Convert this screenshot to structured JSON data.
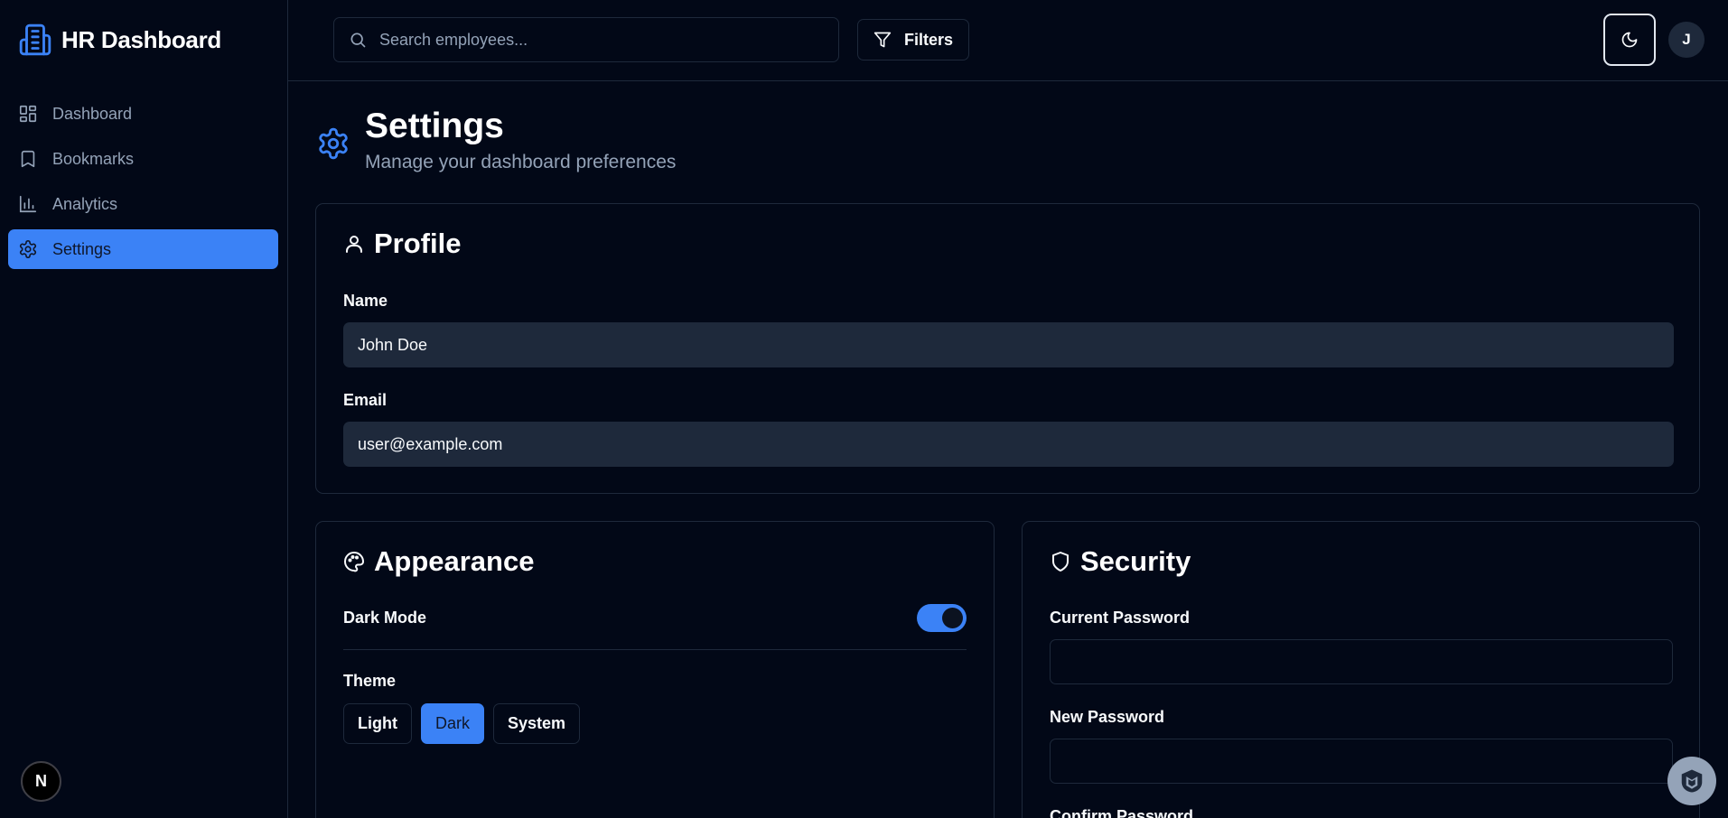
{
  "app": {
    "title": "HR Dashboard"
  },
  "sidebar": {
    "items": [
      {
        "label": "Dashboard",
        "icon": "dashboard-icon",
        "active": false
      },
      {
        "label": "Bookmarks",
        "icon": "bookmark-icon",
        "active": false
      },
      {
        "label": "Analytics",
        "icon": "analytics-icon",
        "active": false
      },
      {
        "label": "Settings",
        "icon": "gear-icon",
        "active": true
      }
    ],
    "badge": "N"
  },
  "header": {
    "search_placeholder": "Search employees...",
    "filters_label": "Filters",
    "avatar_initial": "J"
  },
  "page": {
    "title": "Settings",
    "subtitle": "Manage your dashboard preferences"
  },
  "profile": {
    "title": "Profile",
    "name_label": "Name",
    "name_value": "John Doe",
    "email_label": "Email",
    "email_value": "user@example.com"
  },
  "appearance": {
    "title": "Appearance",
    "dark_mode_label": "Dark Mode",
    "dark_mode_on": true,
    "theme_label": "Theme",
    "themes": [
      "Light",
      "Dark",
      "System"
    ],
    "selected_theme": "Dark"
  },
  "security": {
    "title": "Security",
    "current_password_label": "Current Password",
    "new_password_label": "New Password",
    "confirm_password_label": "Confirm Password"
  },
  "colors": {
    "background": "#020817",
    "accent": "#3b82f6",
    "border": "#1e293b",
    "muted_text": "#94a3b8"
  }
}
